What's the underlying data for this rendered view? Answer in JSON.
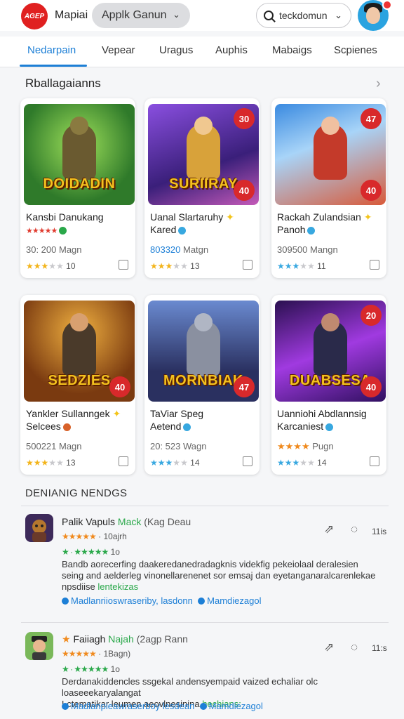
{
  "header": {
    "logo_text": "AGEP",
    "app_title": "Mapiai",
    "app_select": "Applk Ganun",
    "search_value": "teckdomun"
  },
  "tabs": [
    "Nedarpain",
    "Vepear",
    "Uragus",
    "Auphis",
    "Mabaigs",
    "Scpienes"
  ],
  "featured": {
    "title": "Rballagaianns",
    "cards": [
      {
        "art_title": "DOIDADIN",
        "badge": "",
        "name": "Kansbi Danukang",
        "sub_stars": "★★★★★",
        "sub": "",
        "meta": "30: 200 Magn",
        "meta_blue": "",
        "rating_count": "10",
        "stars_on": 3,
        "star_color": "gold",
        "accent": "#2f8a3a"
      },
      {
        "art_title": "SURIIRAY",
        "badge": "40",
        "name": "Uanal Slartaruhy",
        "sub_stars": "",
        "sub": "Kared",
        "meta": " Matgn",
        "meta_blue": "803320",
        "rating_count": "13",
        "stars_on": 3,
        "star_color": "gold",
        "accent": "#7b3fc4"
      },
      {
        "art_title": "",
        "badge": "40",
        "name": "Rackah Zulandsian",
        "sub_stars": "",
        "sub": "Panoh",
        "meta": "309500 Mangn",
        "meta_blue": "",
        "rating_count": "11",
        "stars_on": 3,
        "star_color": "blue",
        "accent": "#3a80d8"
      },
      {
        "art_title": "SEDZIES",
        "badge": "40",
        "name": "Yankler Sullanngek",
        "sub_stars": "",
        "sub": "Selcees",
        "meta": "500221 Magn",
        "meta_blue": "",
        "rating_count": "13",
        "stars_on": 3,
        "star_color": "gold",
        "accent": "#c4621e"
      },
      {
        "art_title": "MORNBIAK",
        "badge": "47",
        "name": "TaViar Speg",
        "sub_stars": "",
        "sub": "Aetend",
        "meta": "20: 523 Wagn",
        "meta_blue": "",
        "rating_count": "14",
        "stars_on": 3,
        "star_color": "blue",
        "accent": "#3f5ea8"
      },
      {
        "art_title": "DUABSESA",
        "badge": "40",
        "name": "Uanniohi Abdlannsig",
        "sub_stars": "",
        "sub": "Karcaniest",
        "meta": "Pugn",
        "meta_blue": "",
        "rating_count": "14",
        "stars_on": 3,
        "star_color": "blue",
        "accent": "#5a2d8c"
      }
    ],
    "top_badges": [
      "",
      "30",
      "47",
      "",
      "",
      "20"
    ]
  },
  "reviews": {
    "title": "DENIANIG NENDGS",
    "items": [
      {
        "name": "Palik Vapuls",
        "name_green": "Mack",
        "name_muted": "(Kag Deau",
        "stars": "★★★★★",
        "stars_text": "10ajrh",
        "gstars_text": "1o",
        "body": "Bandb aorecerfing daakeredanedradagknis videkfig pekeiolaal deralesien seing and aelderleg vinonellarenenet sor emsaj dan eyetanganaralcarenlekae",
        "body_tail": "npsdiise",
        "body_hl": "lentekizas",
        "link1": "Madlanriioswraseriby, lasdonn",
        "link2": "Mamdiezagol",
        "time": "11is",
        "avatar_bg": "#5a3a7a"
      },
      {
        "name": "Faiiagh",
        "name_green": "Najah",
        "name_muted": "(2agp Rann",
        "stars": "★★★★★",
        "stars_text": "1Bagn)",
        "gstars_text": "1o",
        "body": "Derdanakiddencles ssgekal andensyempaid vaized echaliar olc loaseeekaryalangat ",
        "body_tail": "Lctematikar leumen aeovlnesinina",
        "body_hl": "hechians:",
        "link1": "Madlanpieawraserboy lesdean",
        "link2": "Mamdiezagol",
        "time": "11:s",
        "avatar_bg": "#6aa84a"
      }
    ]
  },
  "colors": {
    "accent": "#1d7fd6",
    "badge_red": "#d8292b",
    "rating_gold": "#f3b41a",
    "rating_blue": "#38a8e0",
    "green": "#2aa84a"
  }
}
